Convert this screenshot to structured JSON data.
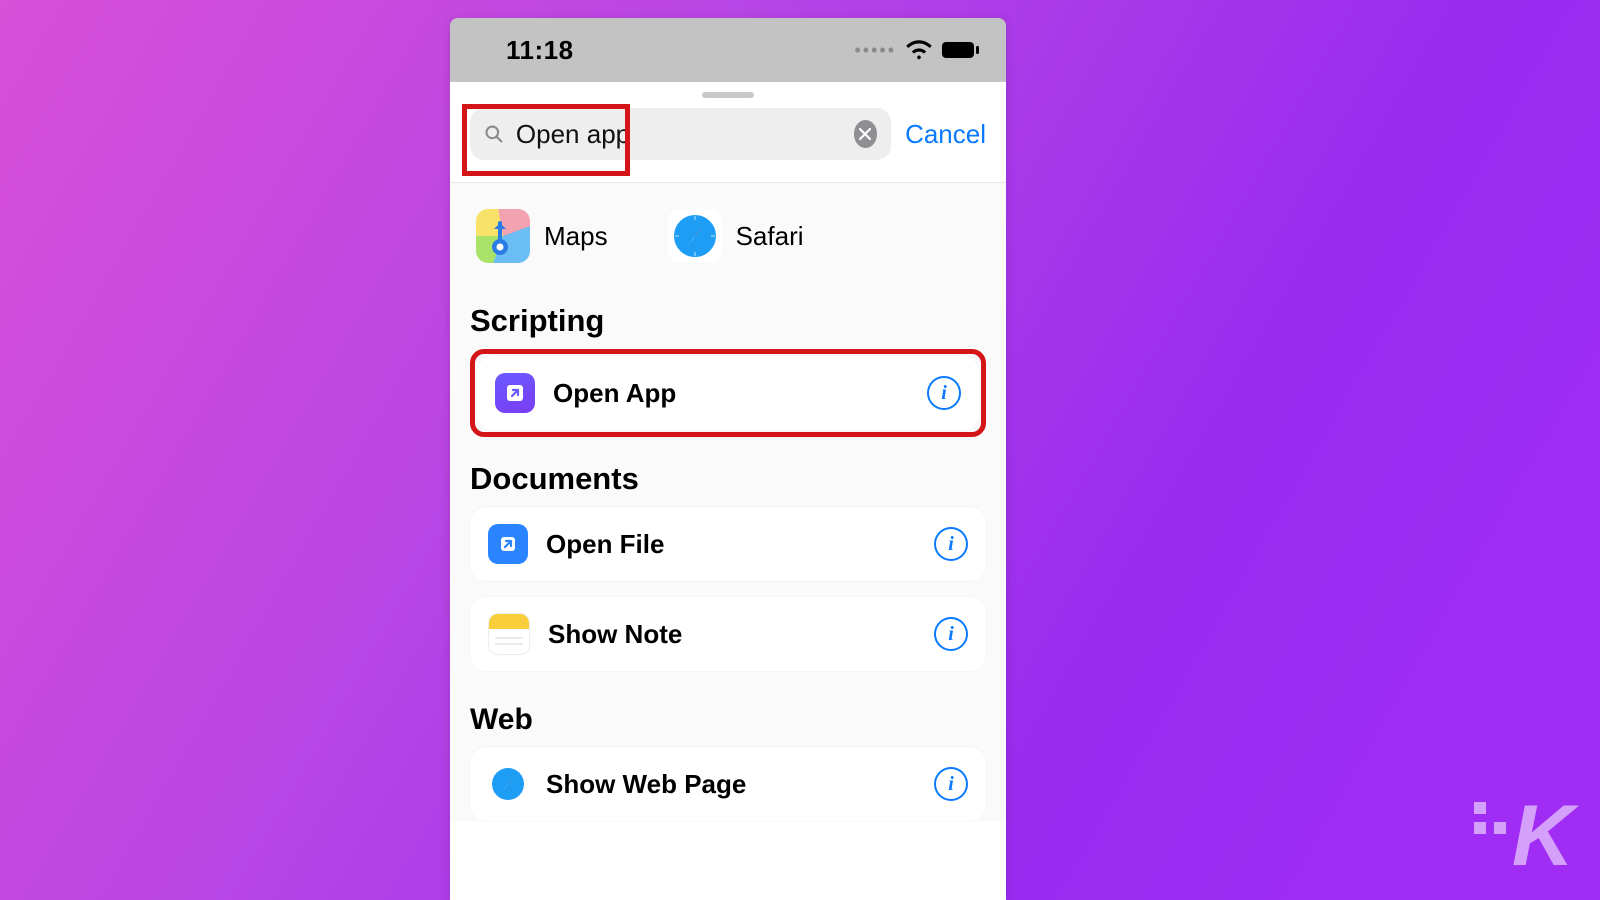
{
  "statusbar": {
    "time": "11:18"
  },
  "search": {
    "value": "Open app",
    "cancel": "Cancel"
  },
  "apps": [
    {
      "name": "Maps"
    },
    {
      "name": "Safari"
    }
  ],
  "sections": {
    "scripting": {
      "title": "Scripting",
      "items": [
        {
          "label": "Open App"
        }
      ]
    },
    "documents": {
      "title": "Documents",
      "items": [
        {
          "label": "Open File"
        },
        {
          "label": "Show Note"
        }
      ]
    },
    "web": {
      "title": "Web",
      "items": [
        {
          "label": "Show Web Page"
        }
      ]
    }
  },
  "watermark": "K"
}
